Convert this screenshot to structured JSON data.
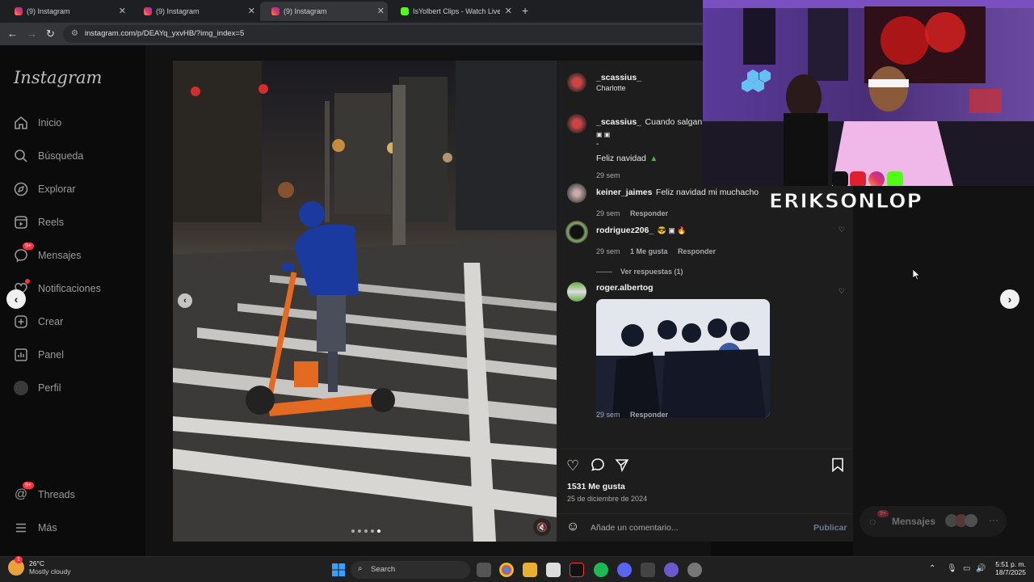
{
  "browser": {
    "tabs": [
      {
        "title": "(9) Instagram",
        "active": false
      },
      {
        "title": "(9) Instagram",
        "active": false
      },
      {
        "title": "(9) Instagram",
        "active": true
      },
      {
        "title": "IsYolbert Clips - Watch Live on",
        "active": false
      }
    ],
    "new_tab_icon": "+",
    "url": "instagram.com/p/DEAYq_yxvHB/?img_index=5"
  },
  "sidebar": {
    "logo": "Instagram",
    "items": [
      {
        "label": "Inicio",
        "icon": "home-icon"
      },
      {
        "label": "Búsqueda",
        "icon": "search-icon"
      },
      {
        "label": "Explorar",
        "icon": "compass-icon"
      },
      {
        "label": "Reels",
        "icon": "reels-icon"
      },
      {
        "label": "Mensajes",
        "icon": "messenger-icon",
        "badge": "9+"
      },
      {
        "label": "Notificaciones",
        "icon": "heart-icon"
      },
      {
        "label": "Crear",
        "icon": "plus-icon"
      },
      {
        "label": "Panel",
        "icon": "dashboard-icon"
      },
      {
        "label": "Perfil",
        "icon": "profile-avatar"
      }
    ],
    "bottom": [
      {
        "label": "Threads",
        "icon": "threads-icon",
        "badge": "9+"
      },
      {
        "label": "Más",
        "icon": "menu-icon"
      }
    ]
  },
  "post": {
    "author": "_scassius_",
    "location": "Charlotte",
    "caption_author": "_scassius_",
    "caption_text": "Cuando salgan ore",
    "caption_line2": "Feliz navidad",
    "caption_time": "29 sem",
    "comments": [
      {
        "user": "keiner_jaimes",
        "text": "Feliz navidad mi muchacho",
        "time": "29 sem",
        "reply": "Responder"
      },
      {
        "user": "rodriguez206_",
        "text": "",
        "time": "29 sem",
        "likes": "1 Me gusta",
        "reply": "Responder",
        "view_replies": "Ver respuestas (1)"
      },
      {
        "user": "roger.albertog",
        "text": "",
        "time": "29 sem",
        "reply": "Responder"
      }
    ],
    "likes": "1531 Me gusta",
    "date": "25 de diciembre de 2024",
    "comment_placeholder": "Añade un comentario...",
    "publish": "Publicar",
    "mute_icon": "muted-speaker-icon"
  },
  "stream": {
    "streamer_name": "ERIKSONLOP",
    "socials": [
      "tiktok-icon",
      "youtube-icon",
      "instagram-icon",
      "kick-icon"
    ]
  },
  "floating_messages": {
    "label": "Mensajes",
    "badge": "9+"
  },
  "taskbar": {
    "weather_temp": "26°C",
    "weather_desc": "Mostly cloudy",
    "weather_badge": "1",
    "search_label": "Search",
    "time": "5:51 p. m.",
    "date": "18/7/2025"
  },
  "colors": {
    "ig_bg": "#0b0b0b",
    "panel_bg": "#1d1d1d",
    "badge_red": "#ff3040",
    "accent_blue": "#4a86e8"
  }
}
